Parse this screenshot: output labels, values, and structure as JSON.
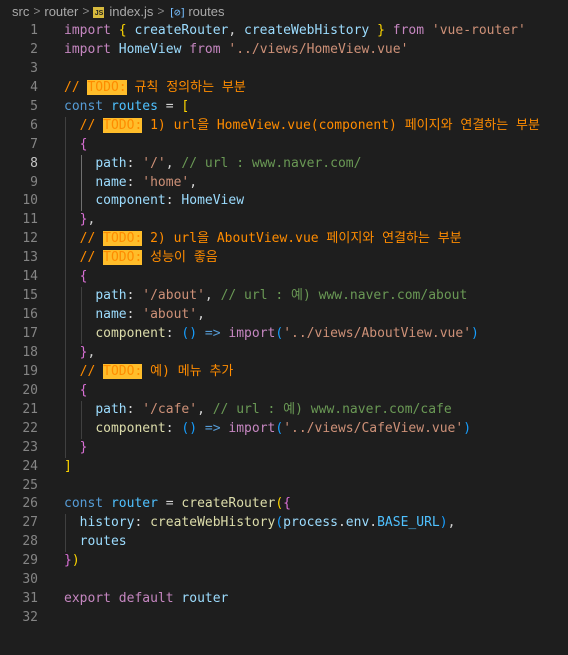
{
  "breadcrumb": {
    "items": [
      "src",
      "router",
      "index.js",
      "routes"
    ],
    "file_icon": "js-file-icon",
    "symbol_icon": "symbol-variable-icon"
  },
  "colors": {
    "background": "#1e1e1e",
    "keyword": "#c586c0",
    "storage": "#569cd6",
    "variable": "#9cdcfe",
    "function": "#dcdcaa",
    "string": "#ce9178",
    "comment": "#6a9955",
    "todo_text": "#ff8c00",
    "todo_highlight": "#ffbd2a"
  },
  "editor": {
    "current_line": 8,
    "lines": [
      {
        "n": "1",
        "guides": [],
        "tokens": [
          [
            "kw",
            "import"
          ],
          [
            "p",
            " "
          ],
          [
            "b1",
            "{"
          ],
          [
            "p",
            " "
          ],
          [
            "var",
            "createRouter"
          ],
          [
            "p",
            ", "
          ],
          [
            "var",
            "createWebHistory"
          ],
          [
            "p",
            " "
          ],
          [
            "b1",
            "}"
          ],
          [
            "p",
            " "
          ],
          [
            "kw",
            "from"
          ],
          [
            "p",
            " "
          ],
          [
            "str",
            "'vue-router'"
          ]
        ]
      },
      {
        "n": "2",
        "guides": [],
        "tokens": [
          [
            "kw",
            "import"
          ],
          [
            "p",
            " "
          ],
          [
            "var",
            "HomeView"
          ],
          [
            "p",
            " "
          ],
          [
            "kw",
            "from"
          ],
          [
            "p",
            " "
          ],
          [
            "str",
            "'../views/HomeView.vue'"
          ]
        ]
      },
      {
        "n": "3",
        "guides": [],
        "tokens": []
      },
      {
        "n": "4",
        "guides": [],
        "tokens": [
          [
            "todo-cmt",
            "// "
          ],
          [
            "todo",
            "TODO:"
          ],
          [
            "todo-cmt",
            " 규칙 정의하는 부분"
          ]
        ]
      },
      {
        "n": "5",
        "guides": [],
        "tokens": [
          [
            "kb",
            "const"
          ],
          [
            "p",
            " "
          ],
          [
            "const",
            "routes"
          ],
          [
            "p",
            " = "
          ],
          [
            "b1",
            "["
          ]
        ]
      },
      {
        "n": "6",
        "guides": [
          0
        ],
        "tokens": [
          [
            "p",
            "  "
          ],
          [
            "todo-cmt",
            "// "
          ],
          [
            "todo",
            "TODO:"
          ],
          [
            "todo-cmt",
            " 1) url을 HomeView.vue(component) 페이지와 연결하는 부분"
          ]
        ]
      },
      {
        "n": "7",
        "guides": [
          0
        ],
        "tokens": [
          [
            "p",
            "  "
          ],
          [
            "b2",
            "{"
          ]
        ]
      },
      {
        "n": "8",
        "guides": [
          0,
          1
        ],
        "active": 1,
        "tokens": [
          [
            "p",
            "    "
          ],
          [
            "var",
            "path"
          ],
          [
            "p",
            ": "
          ],
          [
            "str",
            "'/'"
          ],
          [
            "p",
            ", "
          ],
          [
            "cmt",
            "// url : www.naver.com/"
          ]
        ]
      },
      {
        "n": "9",
        "guides": [
          0,
          1
        ],
        "active": 1,
        "tokens": [
          [
            "p",
            "    "
          ],
          [
            "var",
            "name"
          ],
          [
            "p",
            ": "
          ],
          [
            "str",
            "'home'"
          ],
          [
            "p",
            ","
          ]
        ]
      },
      {
        "n": "10",
        "guides": [
          0,
          1
        ],
        "active": 1,
        "tokens": [
          [
            "p",
            "    "
          ],
          [
            "var",
            "component"
          ],
          [
            "p",
            ": "
          ],
          [
            "var",
            "HomeView"
          ]
        ]
      },
      {
        "n": "11",
        "guides": [
          0
        ],
        "tokens": [
          [
            "p",
            "  "
          ],
          [
            "b2",
            "}"
          ],
          [
            "p",
            ","
          ]
        ]
      },
      {
        "n": "12",
        "guides": [
          0
        ],
        "tokens": [
          [
            "p",
            "  "
          ],
          [
            "todo-cmt",
            "// "
          ],
          [
            "todo",
            "TODO:"
          ],
          [
            "todo-cmt",
            " 2) url을 AboutView.vue 페이지와 연결하는 부분"
          ]
        ]
      },
      {
        "n": "13",
        "guides": [
          0
        ],
        "tokens": [
          [
            "p",
            "  "
          ],
          [
            "todo-cmt",
            "// "
          ],
          [
            "todo",
            "TODO:"
          ],
          [
            "todo-cmt",
            " 성능이 좋음"
          ]
        ]
      },
      {
        "n": "14",
        "guides": [
          0
        ],
        "tokens": [
          [
            "p",
            "  "
          ],
          [
            "b2",
            "{"
          ]
        ]
      },
      {
        "n": "15",
        "guides": [
          0,
          1
        ],
        "tokens": [
          [
            "p",
            "    "
          ],
          [
            "var",
            "path"
          ],
          [
            "p",
            ": "
          ],
          [
            "str",
            "'/about'"
          ],
          [
            "p",
            ", "
          ],
          [
            "cmt",
            "// url : 예) www.naver.com/about"
          ]
        ]
      },
      {
        "n": "16",
        "guides": [
          0,
          1
        ],
        "tokens": [
          [
            "p",
            "    "
          ],
          [
            "var",
            "name"
          ],
          [
            "p",
            ": "
          ],
          [
            "str",
            "'about'"
          ],
          [
            "p",
            ","
          ]
        ]
      },
      {
        "n": "17",
        "guides": [
          0,
          1
        ],
        "tokens": [
          [
            "p",
            "    "
          ],
          [
            "fn",
            "component"
          ],
          [
            "p",
            ": "
          ],
          [
            "b3",
            "()"
          ],
          [
            "p",
            " "
          ],
          [
            "kb",
            "=>"
          ],
          [
            "p",
            " "
          ],
          [
            "kw",
            "import"
          ],
          [
            "b3",
            "("
          ],
          [
            "str",
            "'../views/AboutView.vue'"
          ],
          [
            "b3",
            ")"
          ]
        ]
      },
      {
        "n": "18",
        "guides": [
          0
        ],
        "tokens": [
          [
            "p",
            "  "
          ],
          [
            "b2",
            "}"
          ],
          [
            "p",
            ","
          ]
        ]
      },
      {
        "n": "19",
        "guides": [
          0
        ],
        "tokens": [
          [
            "p",
            "  "
          ],
          [
            "todo-cmt",
            "// "
          ],
          [
            "todo",
            "TODO:"
          ],
          [
            "todo-cmt",
            " 예) 메뉴 추가"
          ]
        ]
      },
      {
        "n": "20",
        "guides": [
          0
        ],
        "tokens": [
          [
            "p",
            "  "
          ],
          [
            "b2",
            "{"
          ]
        ]
      },
      {
        "n": "21",
        "guides": [
          0,
          1
        ],
        "tokens": [
          [
            "p",
            "    "
          ],
          [
            "var",
            "path"
          ],
          [
            "p",
            ": "
          ],
          [
            "str",
            "'/cafe'"
          ],
          [
            "p",
            ", "
          ],
          [
            "cmt",
            "// url : 예) www.naver.com/cafe"
          ]
        ]
      },
      {
        "n": "22",
        "guides": [
          0,
          1
        ],
        "tokens": [
          [
            "p",
            "    "
          ],
          [
            "fn",
            "component"
          ],
          [
            "p",
            ": "
          ],
          [
            "b3",
            "()"
          ],
          [
            "p",
            " "
          ],
          [
            "kb",
            "=>"
          ],
          [
            "p",
            " "
          ],
          [
            "kw",
            "import"
          ],
          [
            "b3",
            "("
          ],
          [
            "str",
            "'../views/CafeView.vue'"
          ],
          [
            "b3",
            ")"
          ]
        ]
      },
      {
        "n": "23",
        "guides": [
          0
        ],
        "tokens": [
          [
            "p",
            "  "
          ],
          [
            "b2",
            "}"
          ]
        ]
      },
      {
        "n": "24",
        "guides": [],
        "tokens": [
          [
            "b1",
            "]"
          ]
        ]
      },
      {
        "n": "25",
        "guides": [],
        "tokens": []
      },
      {
        "n": "26",
        "guides": [],
        "tokens": [
          [
            "kb",
            "const"
          ],
          [
            "p",
            " "
          ],
          [
            "const",
            "router"
          ],
          [
            "p",
            " = "
          ],
          [
            "fn",
            "createRouter"
          ],
          [
            "b1",
            "("
          ],
          [
            "b2",
            "{"
          ]
        ]
      },
      {
        "n": "27",
        "guides": [
          0
        ],
        "tokens": [
          [
            "p",
            "  "
          ],
          [
            "var",
            "history"
          ],
          [
            "p",
            ": "
          ],
          [
            "fn",
            "createWebHistory"
          ],
          [
            "b3",
            "("
          ],
          [
            "var",
            "process"
          ],
          [
            "p",
            "."
          ],
          [
            "var",
            "env"
          ],
          [
            "p",
            "."
          ],
          [
            "const",
            "BASE_URL"
          ],
          [
            "b3",
            ")"
          ],
          [
            "p",
            ","
          ]
        ]
      },
      {
        "n": "28",
        "guides": [
          0
        ],
        "tokens": [
          [
            "p",
            "  "
          ],
          [
            "var",
            "routes"
          ]
        ]
      },
      {
        "n": "29",
        "guides": [],
        "tokens": [
          [
            "b2",
            "}"
          ],
          [
            "b1",
            ")"
          ]
        ]
      },
      {
        "n": "30",
        "guides": [],
        "tokens": []
      },
      {
        "n": "31",
        "guides": [],
        "tokens": [
          [
            "kw",
            "export"
          ],
          [
            "p",
            " "
          ],
          [
            "kw",
            "default"
          ],
          [
            "p",
            " "
          ],
          [
            "var",
            "router"
          ]
        ]
      },
      {
        "n": "32",
        "guides": [],
        "tokens": []
      }
    ]
  }
}
